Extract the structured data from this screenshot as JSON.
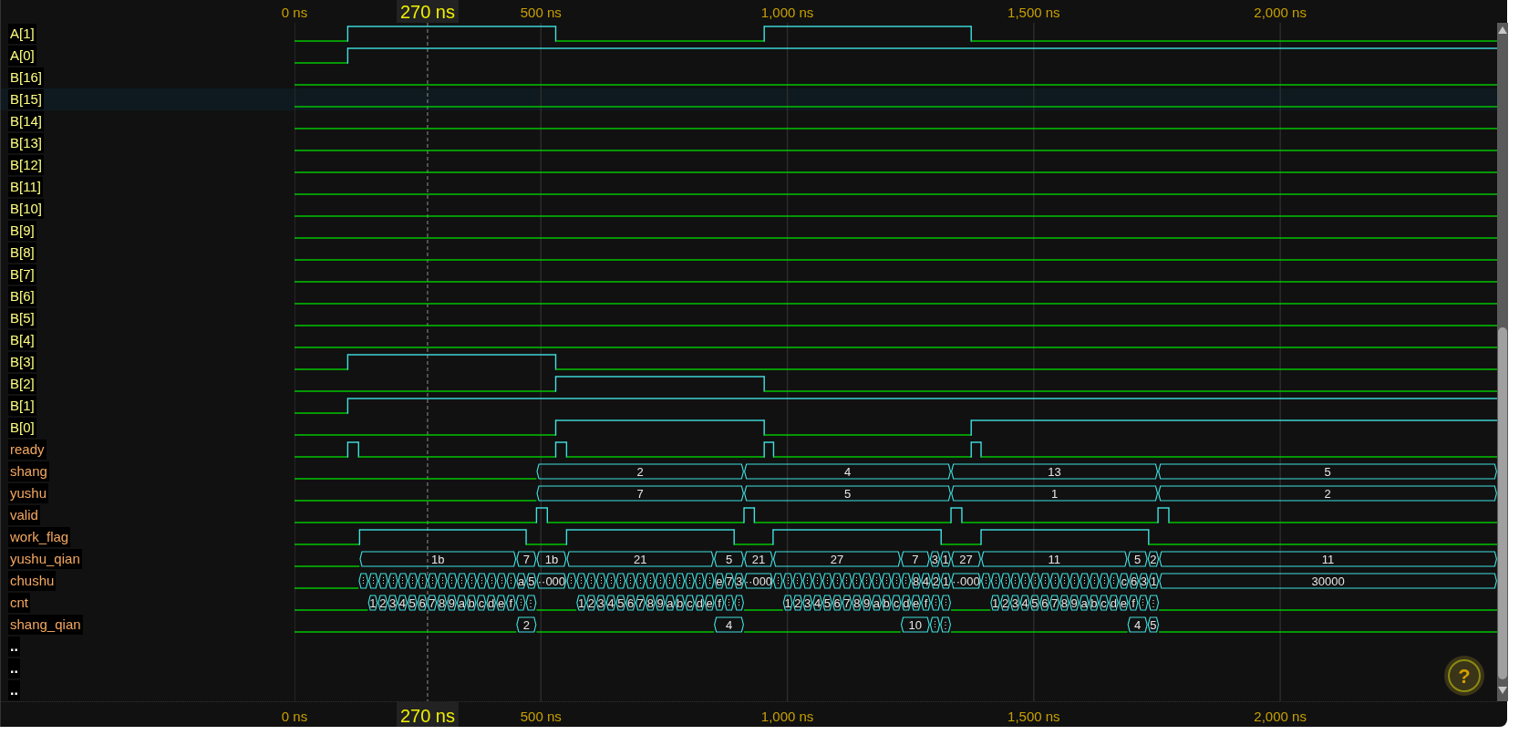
{
  "timeline_top": {
    "ticks": [
      {
        "label": "0 ns"
      },
      {
        "label": "500 ns"
      },
      {
        "label": "1,000 ns"
      },
      {
        "label": "1,500 ns"
      },
      {
        "label": "2,000 ns"
      }
    ],
    "cursor_label": "270 ns"
  },
  "timeline_bottom": {
    "ticks": [
      {
        "label": "0 ns"
      },
      {
        "label": "500 ns"
      },
      {
        "label": "1,000 ns"
      },
      {
        "label": "1,500 ns"
      },
      {
        "label": "2,000 ns"
      }
    ],
    "cursor_label": "270 ns"
  },
  "signals": [
    {
      "name": "A[1]",
      "kind": "bit",
      "color": "#ffff80",
      "selected": false,
      "levels": [
        {
          "high": false
        },
        {
          "high": true
        },
        {
          "high": false
        },
        {
          "high": true
        },
        {
          "high": false
        }
      ]
    },
    {
      "name": "A[0]",
      "kind": "bit",
      "color": "#ffff80",
      "selected": false,
      "levels": [
        {
          "high": false
        },
        {
          "high": true
        }
      ]
    },
    {
      "name": "B[16]",
      "kind": "bit",
      "color": "#ffff80",
      "selected": false,
      "levels": [
        {
          "high": false
        }
      ]
    },
    {
      "name": "B[15]",
      "kind": "bit",
      "color": "#ffff80",
      "selected": true,
      "levels": [
        {
          "high": false
        }
      ]
    },
    {
      "name": "B[14]",
      "kind": "bit",
      "color": "#ffff80",
      "selected": false,
      "levels": [
        {
          "high": false
        }
      ]
    },
    {
      "name": "B[13]",
      "kind": "bit",
      "color": "#ffff80",
      "selected": false,
      "levels": [
        {
          "high": false
        }
      ]
    },
    {
      "name": "B[12]",
      "kind": "bit",
      "color": "#ffff80",
      "selected": false,
      "levels": [
        {
          "high": false
        }
      ]
    },
    {
      "name": "B[11]",
      "kind": "bit",
      "color": "#ffff80",
      "selected": false,
      "levels": [
        {
          "high": false
        }
      ]
    },
    {
      "name": "B[10]",
      "kind": "bit",
      "color": "#ffff80",
      "selected": false,
      "levels": [
        {
          "high": false
        }
      ]
    },
    {
      "name": "B[9]",
      "kind": "bit",
      "color": "#ffff80",
      "selected": false,
      "levels": [
        {
          "high": false
        }
      ]
    },
    {
      "name": "B[8]",
      "kind": "bit",
      "color": "#ffff80",
      "selected": false,
      "levels": [
        {
          "high": false
        }
      ]
    },
    {
      "name": "B[7]",
      "kind": "bit",
      "color": "#ffff80",
      "selected": false,
      "levels": [
        {
          "high": false
        }
      ]
    },
    {
      "name": "B[6]",
      "kind": "bit",
      "color": "#ffff80",
      "selected": false,
      "levels": [
        {
          "high": false
        }
      ]
    },
    {
      "name": "B[5]",
      "kind": "bit",
      "color": "#ffff80",
      "selected": false,
      "levels": [
        {
          "high": false
        }
      ]
    },
    {
      "name": "B[4]",
      "kind": "bit",
      "color": "#ffff80",
      "selected": false,
      "levels": [
        {
          "high": false
        }
      ]
    },
    {
      "name": "B[3]",
      "kind": "bit",
      "color": "#ffff80",
      "selected": false,
      "levels": [
        {
          "high": false
        },
        {
          "high": true
        },
        {
          "high": false
        }
      ]
    },
    {
      "name": "B[2]",
      "kind": "bit",
      "color": "#ffff80",
      "selected": false,
      "levels": [
        {
          "high": false
        },
        {
          "high": true
        },
        {
          "high": false
        }
      ]
    },
    {
      "name": "B[1]",
      "kind": "bit",
      "color": "#ffff80",
      "selected": false,
      "levels": [
        {
          "high": false
        },
        {
          "high": true
        }
      ]
    },
    {
      "name": "B[0]",
      "kind": "bit",
      "color": "#ffff80",
      "selected": false,
      "levels": [
        {
          "high": false
        },
        {
          "high": true
        },
        {
          "high": false
        },
        {
          "high": true
        }
      ]
    },
    {
      "name": "ready",
      "kind": "bit",
      "color": "#f5a860",
      "selected": false,
      "levels": [
        {
          "high": false
        },
        {
          "high": true
        },
        {
          "high": false
        },
        {
          "high": true
        },
        {
          "high": false
        },
        {
          "high": true
        },
        {
          "high": false
        },
        {
          "high": true
        },
        {
          "high": false
        }
      ]
    },
    {
      "name": "shang",
      "kind": "bus",
      "color": "#f5a860",
      "selected": false,
      "pieces": [
        {
          "kind": "low"
        },
        {
          "kind": "data",
          "value": "2"
        },
        {
          "kind": "data",
          "value": "4"
        },
        {
          "kind": "data",
          "value": "13"
        },
        {
          "kind": "data",
          "value": "5"
        }
      ]
    },
    {
      "name": "yushu",
      "kind": "bus",
      "color": "#f5a860",
      "selected": false,
      "pieces": [
        {
          "kind": "low"
        },
        {
          "kind": "data",
          "value": "7"
        },
        {
          "kind": "data",
          "value": "5"
        },
        {
          "kind": "data",
          "value": "1"
        },
        {
          "kind": "data",
          "value": "2"
        }
      ]
    },
    {
      "name": "valid",
      "kind": "bit",
      "color": "#f5a860",
      "selected": false,
      "levels": [
        {
          "high": false
        },
        {
          "high": true
        },
        {
          "high": false
        },
        {
          "high": true
        },
        {
          "high": false
        },
        {
          "high": true
        },
        {
          "high": false
        },
        {
          "high": true
        },
        {
          "high": false
        }
      ]
    },
    {
      "name": "work_flag",
      "kind": "bit",
      "color": "#f5a860",
      "selected": false,
      "levels": [
        {
          "high": false
        },
        {
          "high": true
        },
        {
          "high": false
        },
        {
          "high": true
        },
        {
          "high": false
        },
        {
          "high": true
        },
        {
          "high": false
        },
        {
          "high": true
        },
        {
          "high": false
        }
      ]
    },
    {
      "name": "yushu_qian",
      "kind": "bus",
      "color": "#f5a860",
      "selected": false,
      "pieces": [
        {
          "kind": "low"
        },
        {
          "kind": "data",
          "value": "1b"
        },
        {
          "kind": "data",
          "value": "7"
        },
        {
          "kind": "data",
          "value": "1b"
        },
        {
          "kind": "data",
          "value": "21"
        },
        {
          "kind": "data",
          "value": "5"
        },
        {
          "kind": "data",
          "value": "21"
        },
        {
          "kind": "data",
          "value": "27"
        },
        {
          "kind": "data",
          "value": "7"
        },
        {
          "kind": "data",
          "value": "3"
        },
        {
          "kind": "data",
          "value": "1"
        },
        {
          "kind": "data",
          "value": "27"
        },
        {
          "kind": "data",
          "value": "11"
        },
        {
          "kind": "data",
          "value": "5"
        },
        {
          "kind": "data",
          "value": "2"
        },
        {
          "kind": "data",
          "value": "11"
        }
      ]
    },
    {
      "name": "chushu",
      "kind": "bus",
      "color": "#f5a860",
      "selected": false,
      "pieces": [
        {
          "kind": "low"
        },
        {
          "kind": "data",
          "value": "⋮"
        },
        {
          "kind": "data",
          "value": "⋮"
        },
        {
          "kind": "data",
          "value": "⋮"
        },
        {
          "kind": "data",
          "value": "⋮"
        },
        {
          "kind": "data",
          "value": "⋮"
        },
        {
          "kind": "data",
          "value": "⋮"
        },
        {
          "kind": "data",
          "value": "⋮"
        },
        {
          "kind": "data",
          "value": "⋮"
        },
        {
          "kind": "data",
          "value": "⋮"
        },
        {
          "kind": "data",
          "value": "⋮"
        },
        {
          "kind": "data",
          "value": "⋮"
        },
        {
          "kind": "data",
          "value": "⋮"
        },
        {
          "kind": "data",
          "value": "⋮"
        },
        {
          "kind": "data",
          "value": "⋮"
        },
        {
          "kind": "data",
          "value": "⋮"
        },
        {
          "kind": "data",
          "value": "⋮"
        },
        {
          "kind": "data",
          "value": "a"
        },
        {
          "kind": "data",
          "value": "5"
        },
        {
          "kind": "data",
          "value": "··000"
        },
        {
          "kind": "data",
          "value": "⋮"
        },
        {
          "kind": "data",
          "value": "⋮"
        },
        {
          "kind": "data",
          "value": "⋮"
        },
        {
          "kind": "data",
          "value": "⋮"
        },
        {
          "kind": "data",
          "value": "⋮"
        },
        {
          "kind": "data",
          "value": "⋮"
        },
        {
          "kind": "data",
          "value": "⋮"
        },
        {
          "kind": "data",
          "value": "⋮"
        },
        {
          "kind": "data",
          "value": "⋮"
        },
        {
          "kind": "data",
          "value": "⋮"
        },
        {
          "kind": "data",
          "value": "⋮"
        },
        {
          "kind": "data",
          "value": "⋮"
        },
        {
          "kind": "data",
          "value": "⋮"
        },
        {
          "kind": "data",
          "value": "⋮"
        },
        {
          "kind": "data",
          "value": "⋮"
        },
        {
          "kind": "data",
          "value": "e"
        },
        {
          "kind": "data",
          "value": "7"
        },
        {
          "kind": "data",
          "value": "3"
        },
        {
          "kind": "data",
          "value": "··000"
        },
        {
          "kind": "data",
          "value": "⋮"
        },
        {
          "kind": "data",
          "value": "⋮"
        },
        {
          "kind": "data",
          "value": "⋮"
        },
        {
          "kind": "data",
          "value": "⋮"
        },
        {
          "kind": "data",
          "value": "⋮"
        },
        {
          "kind": "data",
          "value": "⋮"
        },
        {
          "kind": "data",
          "value": "⋮"
        },
        {
          "kind": "data",
          "value": "⋮"
        },
        {
          "kind": "data",
          "value": "⋮"
        },
        {
          "kind": "data",
          "value": "⋮"
        },
        {
          "kind": "data",
          "value": "⋮"
        },
        {
          "kind": "data",
          "value": "⋮"
        },
        {
          "kind": "data",
          "value": "⋮"
        },
        {
          "kind": "data",
          "value": "⋮"
        },
        {
          "kind": "data",
          "value": "8"
        },
        {
          "kind": "data",
          "value": "4"
        },
        {
          "kind": "data",
          "value": "2"
        },
        {
          "kind": "data",
          "value": "1"
        },
        {
          "kind": "data",
          "value": "··000"
        },
        {
          "kind": "data",
          "value": "⋮"
        },
        {
          "kind": "data",
          "value": "⋮"
        },
        {
          "kind": "data",
          "value": "⋮"
        },
        {
          "kind": "data",
          "value": "⋮"
        },
        {
          "kind": "data",
          "value": "⋮"
        },
        {
          "kind": "data",
          "value": "⋮"
        },
        {
          "kind": "data",
          "value": "⋮"
        },
        {
          "kind": "data",
          "value": "⋮"
        },
        {
          "kind": "data",
          "value": "⋮"
        },
        {
          "kind": "data",
          "value": "⋮"
        },
        {
          "kind": "data",
          "value": "⋮"
        },
        {
          "kind": "data",
          "value": "⋮"
        },
        {
          "kind": "data",
          "value": "⋮"
        },
        {
          "kind": "data",
          "value": "⋮"
        },
        {
          "kind": "data",
          "value": "c"
        },
        {
          "kind": "data",
          "value": "6"
        },
        {
          "kind": "data",
          "value": "3"
        },
        {
          "kind": "data",
          "value": "1"
        },
        {
          "kind": "data",
          "value": "30000"
        }
      ]
    },
    {
      "name": "cnt",
      "kind": "bus",
      "color": "#f5a860",
      "selected": false,
      "pieces": [
        {
          "kind": "low"
        },
        {
          "kind": "data",
          "value": "1"
        },
        {
          "kind": "data",
          "value": "2"
        },
        {
          "kind": "data",
          "value": "3"
        },
        {
          "kind": "data",
          "value": "4"
        },
        {
          "kind": "data",
          "value": "5"
        },
        {
          "kind": "data",
          "value": "6"
        },
        {
          "kind": "data",
          "value": "7"
        },
        {
          "kind": "data",
          "value": "8"
        },
        {
          "kind": "data",
          "value": "9"
        },
        {
          "kind": "data",
          "value": "a"
        },
        {
          "kind": "data",
          "value": "b"
        },
        {
          "kind": "data",
          "value": "c"
        },
        {
          "kind": "data",
          "value": "d"
        },
        {
          "kind": "data",
          "value": "e"
        },
        {
          "kind": "data",
          "value": "f"
        },
        {
          "kind": "data",
          "value": "⋮"
        },
        {
          "kind": "data",
          "value": "⋮"
        },
        {
          "kind": "low"
        },
        {
          "kind": "data",
          "value": "1"
        },
        {
          "kind": "data",
          "value": "2"
        },
        {
          "kind": "data",
          "value": "3"
        },
        {
          "kind": "data",
          "value": "4"
        },
        {
          "kind": "data",
          "value": "5"
        },
        {
          "kind": "data",
          "value": "6"
        },
        {
          "kind": "data",
          "value": "7"
        },
        {
          "kind": "data",
          "value": "8"
        },
        {
          "kind": "data",
          "value": "9"
        },
        {
          "kind": "data",
          "value": "a"
        },
        {
          "kind": "data",
          "value": "b"
        },
        {
          "kind": "data",
          "value": "c"
        },
        {
          "kind": "data",
          "value": "d"
        },
        {
          "kind": "data",
          "value": "e"
        },
        {
          "kind": "data",
          "value": "f"
        },
        {
          "kind": "data",
          "value": "⋮"
        },
        {
          "kind": "data",
          "value": "⋮"
        },
        {
          "kind": "low"
        },
        {
          "kind": "data",
          "value": "1"
        },
        {
          "kind": "data",
          "value": "2"
        },
        {
          "kind": "data",
          "value": "3"
        },
        {
          "kind": "data",
          "value": "4"
        },
        {
          "kind": "data",
          "value": "5"
        },
        {
          "kind": "data",
          "value": "6"
        },
        {
          "kind": "data",
          "value": "7"
        },
        {
          "kind": "data",
          "value": "8"
        },
        {
          "kind": "data",
          "value": "9"
        },
        {
          "kind": "data",
          "value": "a"
        },
        {
          "kind": "data",
          "value": "b"
        },
        {
          "kind": "data",
          "value": "c"
        },
        {
          "kind": "data",
          "value": "d"
        },
        {
          "kind": "data",
          "value": "e"
        },
        {
          "kind": "data",
          "value": "f"
        },
        {
          "kind": "data",
          "value": "⋮"
        },
        {
          "kind": "data",
          "value": "⋮"
        },
        {
          "kind": "low"
        },
        {
          "kind": "data",
          "value": "1"
        },
        {
          "kind": "data",
          "value": "2"
        },
        {
          "kind": "data",
          "value": "3"
        },
        {
          "kind": "data",
          "value": "4"
        },
        {
          "kind": "data",
          "value": "5"
        },
        {
          "kind": "data",
          "value": "6"
        },
        {
          "kind": "data",
          "value": "7"
        },
        {
          "kind": "data",
          "value": "8"
        },
        {
          "kind": "data",
          "value": "9"
        },
        {
          "kind": "data",
          "value": "a"
        },
        {
          "kind": "data",
          "value": "b"
        },
        {
          "kind": "data",
          "value": "c"
        },
        {
          "kind": "data",
          "value": "d"
        },
        {
          "kind": "data",
          "value": "e"
        },
        {
          "kind": "data",
          "value": "f"
        },
        {
          "kind": "data",
          "value": "⋮"
        },
        {
          "kind": "data",
          "value": "⋮"
        },
        {
          "kind": "low"
        }
      ]
    },
    {
      "name": "shang_qian",
      "kind": "bus",
      "color": "#f5a860",
      "selected": false,
      "pieces": [
        {
          "kind": "low"
        },
        {
          "kind": "data",
          "value": "2"
        },
        {
          "kind": "low"
        },
        {
          "kind": "data",
          "value": "4"
        },
        {
          "kind": "low"
        },
        {
          "kind": "data",
          "value": "10"
        },
        {
          "kind": "data",
          "value": "⋮"
        },
        {
          "kind": "data",
          "value": "⋮"
        },
        {
          "kind": "low"
        },
        {
          "kind": "data",
          "value": "4"
        },
        {
          "kind": "data",
          "value": "5"
        },
        {
          "kind": "low"
        }
      ]
    },
    {
      "name": "..",
      "kind": "spacer",
      "color": "#ffffff",
      "selected": false
    },
    {
      "name": "..",
      "kind": "spacer",
      "color": "#ffffff",
      "selected": false
    },
    {
      "name": "..",
      "kind": "spacer",
      "color": "#ffffff",
      "selected": false
    }
  ],
  "help_button": {
    "label": "?"
  }
}
